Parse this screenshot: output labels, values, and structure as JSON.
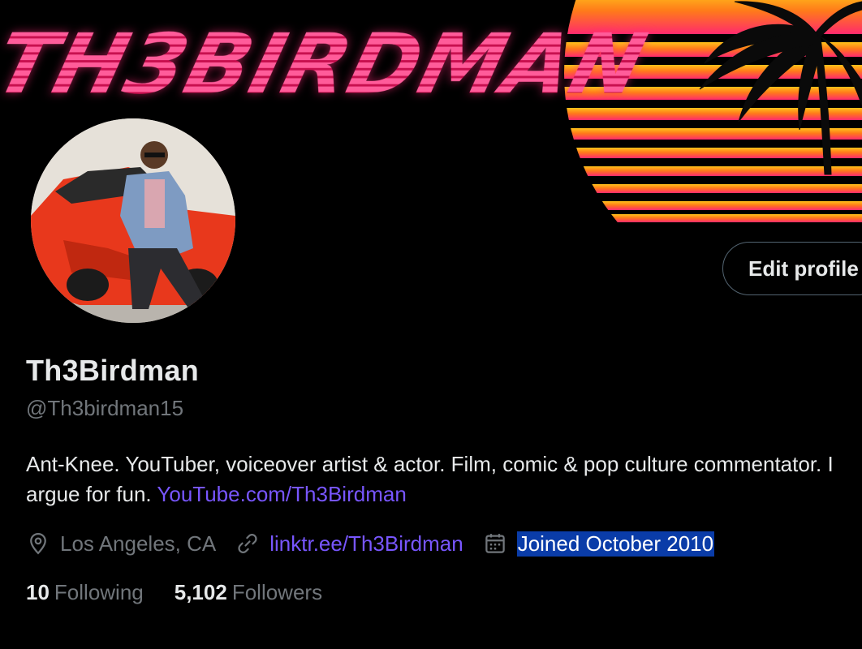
{
  "banner": {
    "logo_text": "TH3BIRDMAN",
    "colors": {
      "logo_pink": "#ff2f7a",
      "sun_top": "#ffb31a",
      "sun_bottom": "#ff2a6d"
    }
  },
  "profile": {
    "display_name": "Th3Birdman",
    "handle": "@Th3birdman15",
    "bio_text": "Ant-Knee.  YouTuber, voiceover artist & actor. Film, comic & pop culture commentator. I argue for fun. ",
    "bio_link": "YouTube.com/Th3Birdman",
    "location": "Los Angeles, CA",
    "website": "linktr.ee/Th3Birdman",
    "joined": "Joined October 2010",
    "edit_button": "Edit profile"
  },
  "stats": {
    "following_count": "10",
    "following_label": "Following",
    "followers_count": "5,102",
    "followers_label": "Followers"
  },
  "icons": {
    "location": "location-pin-icon",
    "link": "link-icon",
    "calendar": "calendar-icon"
  },
  "theme": {
    "background": "#000000",
    "text_primary": "#e7e9ea",
    "text_secondary": "#71767b",
    "link": "#7856ff",
    "selection": "#0a3ca8"
  }
}
